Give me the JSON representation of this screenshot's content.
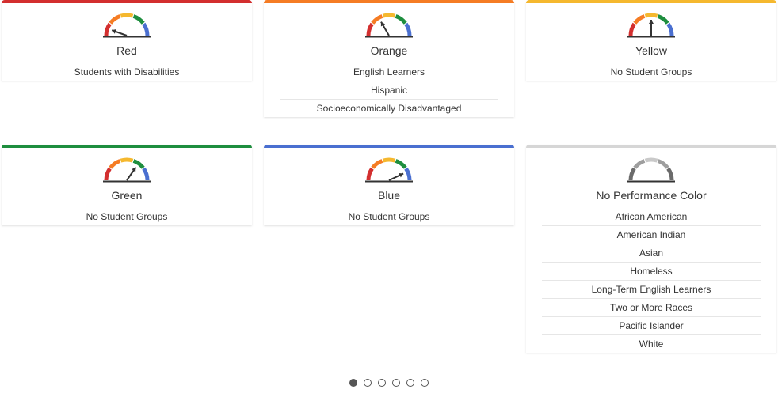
{
  "cards": [
    {
      "color": "#d32f2f",
      "title": "Red",
      "needle": 0,
      "gray": false,
      "groups": [
        "Students with Disabilities"
      ]
    },
    {
      "color": "#f57c24",
      "title": "Orange",
      "needle": 1,
      "gray": false,
      "groups": [
        "English Learners",
        "Hispanic",
        "Socioeconomically Disadvantaged"
      ]
    },
    {
      "color": "#f5b82e",
      "title": "Yellow",
      "needle": 2,
      "gray": false,
      "groups": [
        "No Student Groups"
      ]
    },
    {
      "color": "#1e8e3e",
      "title": "Green",
      "needle": 3,
      "gray": false,
      "groups": [
        "No Student Groups"
      ]
    },
    {
      "color": "#4a6fd0",
      "title": "Blue",
      "needle": 4,
      "gray": false,
      "groups": [
        "No Student Groups"
      ]
    },
    {
      "color": "#d6d6d6",
      "title": "No Performance Color",
      "needle": null,
      "gray": true,
      "groups": [
        "African American",
        "American Indian",
        "Asian",
        "Homeless",
        "Long-Term English Learners",
        "Two or More Races",
        "Pacific Islander",
        "White"
      ]
    }
  ],
  "pagination": {
    "total": 6,
    "active": 0
  },
  "palette": {
    "segments": [
      "#d32f2f",
      "#f57c24",
      "#f5b82e",
      "#1e8e3e",
      "#4a6fd0"
    ],
    "gray_segments": [
      "#6b6b6b",
      "#9e9e9e",
      "#c9c9c9",
      "#9e9e9e",
      "#6b6b6b"
    ],
    "needle": "#333333",
    "baseline": "#333333"
  }
}
